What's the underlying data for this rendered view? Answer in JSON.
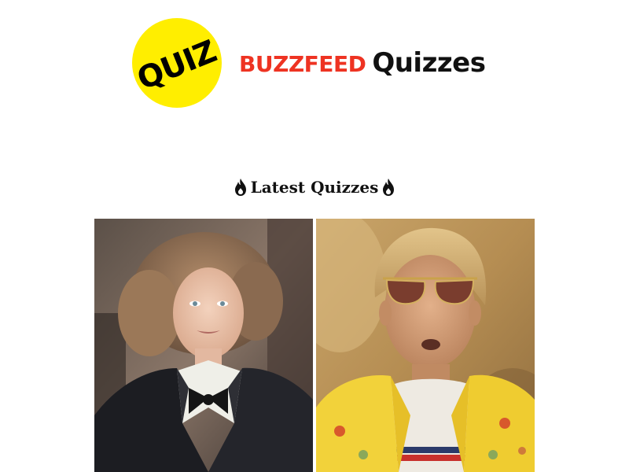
{
  "header": {
    "badge_text": "QUIZ",
    "brand_name": "BuzzFeed",
    "brand_suffix": "Quizzes",
    "colors": {
      "badge_yellow": "#ffee00",
      "brand_red": "#ee3322"
    }
  },
  "latest": {
    "heading": "Latest Quizzes",
    "icon": "flame-icon",
    "quizzes": [
      {
        "image": "woman-curly-hair-dark-coat-photo"
      },
      {
        "image": "man-aviator-sunglasses-yellow-shirt-photo"
      }
    ]
  }
}
